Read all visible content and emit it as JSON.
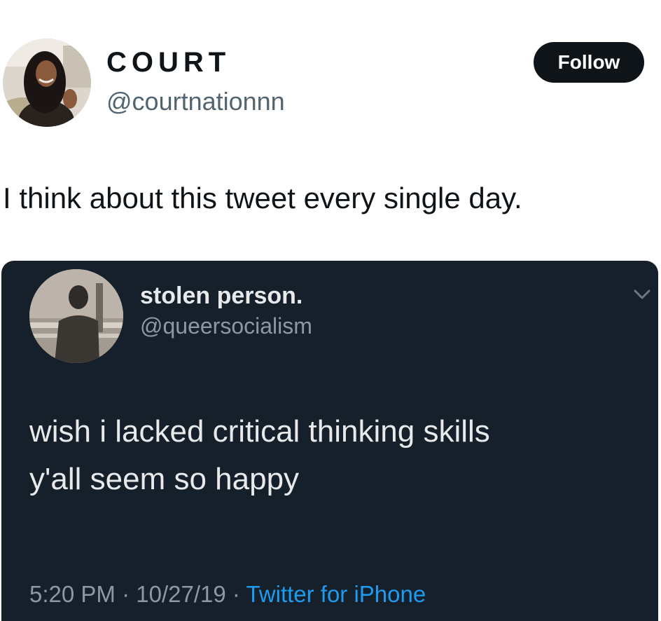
{
  "tweet": {
    "author": {
      "display_name": "COURT",
      "handle": "@courtnationnn",
      "avatar_icon": "profile-photo"
    },
    "follow_label": "Follow",
    "text": "I think about this tweet every single day."
  },
  "embedded_tweet": {
    "author": {
      "display_name": "stolen person.",
      "handle": "@queersocialism",
      "avatar_icon": "profile-photo"
    },
    "more_icon": "chevron-down-icon",
    "text": "wish i lacked critical thinking skills\ny'all seem so happy",
    "time": "5:20 PM",
    "date": "10/27/19",
    "source": "Twitter for iPhone",
    "separator": " · "
  },
  "colors": {
    "follow_bg": "#0f1419",
    "card_bg": "#15202b",
    "link_blue": "#1d9bf0",
    "muted_light": "#536471",
    "muted_dark": "#8b98a5"
  }
}
